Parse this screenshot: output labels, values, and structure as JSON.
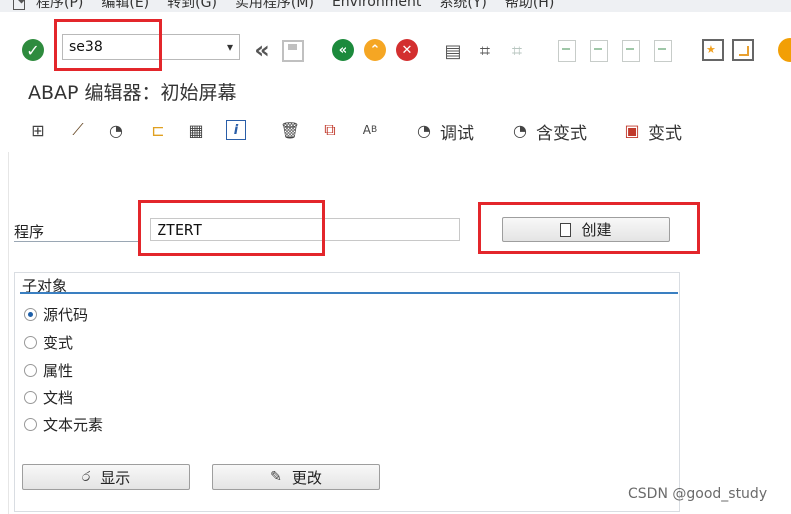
{
  "menubar": {
    "items": [
      "程序(P)",
      "编辑(E)",
      "转到(G)",
      "实用程序(M)",
      "Environment",
      "系统(Y)",
      "帮助(H)"
    ]
  },
  "system_toolbar": {
    "command_value": "se38",
    "icons": [
      "check-icon",
      "dropdown-icon",
      "double-chevron-left-icon",
      "save-icon",
      "back-icon",
      "exit-icon",
      "cancel-icon",
      "print-icon",
      "find-icon",
      "find-next-icon",
      "first-page-icon",
      "previous-page-icon",
      "next-page-icon",
      "last-page-icon",
      "new-session-icon",
      "create-shortcut-icon",
      "help-icon"
    ]
  },
  "title": "ABAP 编辑器：初始屏幕",
  "app_toolbar": {
    "debug_label": "调试",
    "with_variant_label": "含变式",
    "variant_label": "变式"
  },
  "program": {
    "label": "程序",
    "value": "ZTERT",
    "create_label": "创建"
  },
  "subobjects": {
    "title": "子对象",
    "options": [
      "源代码",
      "变式",
      "属性",
      "文档",
      "文本元素"
    ],
    "selected": "源代码"
  },
  "buttons": {
    "display_label": "显示",
    "change_label": "更改"
  },
  "watermark": "CSDN @good_study",
  "colors": {
    "highlight": "#e3262b",
    "ok_green": "#2e8b3e",
    "exit_yellow": "#f5a623",
    "cancel_red": "#d32f2f",
    "group_rule_blue": "#3a7fc1"
  }
}
